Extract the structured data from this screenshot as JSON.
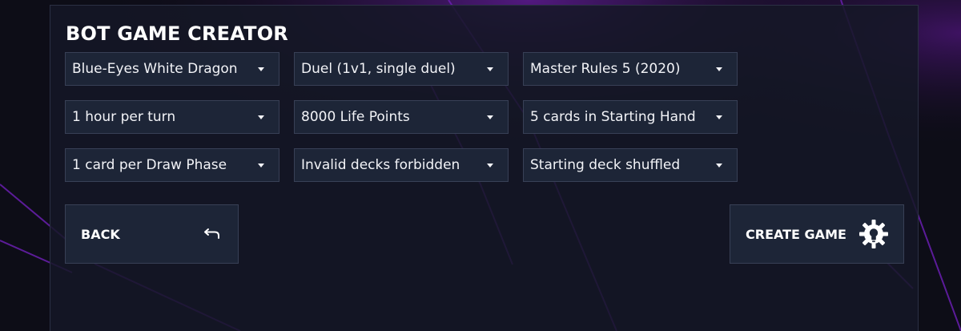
{
  "title": "BOT GAME CREATOR",
  "selects": {
    "deck": "Blue-Eyes White Dragon",
    "mode": "Duel (1v1, single duel)",
    "rules": "Master Rules 5 (2020)",
    "time": "1 hour per turn",
    "life_points": "8000 Life Points",
    "starting_hand": "5 cards in Starting Hand",
    "draw": "1 card per Draw Phase",
    "deck_check": "Invalid decks forbidden",
    "shuffle": "Starting deck shuffled"
  },
  "buttons": {
    "back": "BACK",
    "create": "CREATE GAME"
  },
  "icons": {
    "back": "return-arrow-icon",
    "create": "gear-bulb-icon",
    "dropdown": "caret-down-icon"
  },
  "colors": {
    "background": "#0d0d17",
    "panel": "#151726",
    "control": "#1d2537",
    "border": "#384056",
    "accent_purple": "#6a1fb0",
    "text": "#ffffff"
  }
}
